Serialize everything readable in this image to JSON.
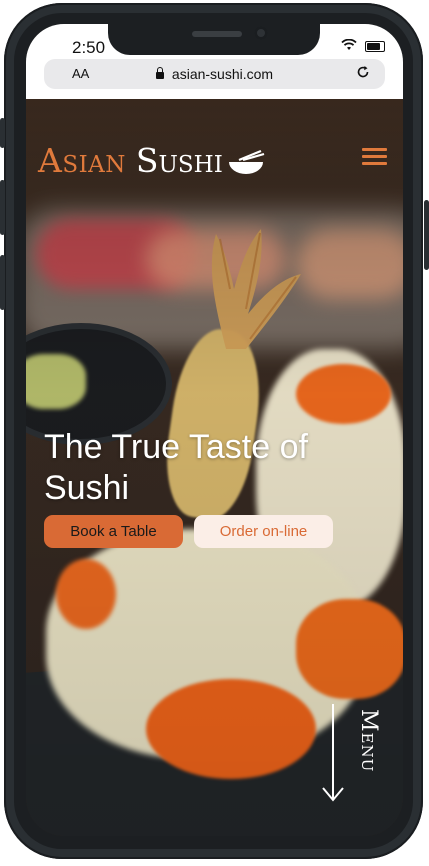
{
  "status_bar": {
    "time": "2:50"
  },
  "browser": {
    "text_size_label": "AA",
    "url": "asian-sushi.com"
  },
  "brand": {
    "word1": "Asian",
    "word2": "Sushi"
  },
  "hero": {
    "headline": "The True Taste of Sushi"
  },
  "buttons": {
    "book": "Book a Table",
    "order": "Order on-line"
  },
  "menu": {
    "label": "Menu"
  },
  "colors": {
    "accent": "#d96a35",
    "order_bg": "#fbeee7",
    "frame": "#2a2f33"
  }
}
